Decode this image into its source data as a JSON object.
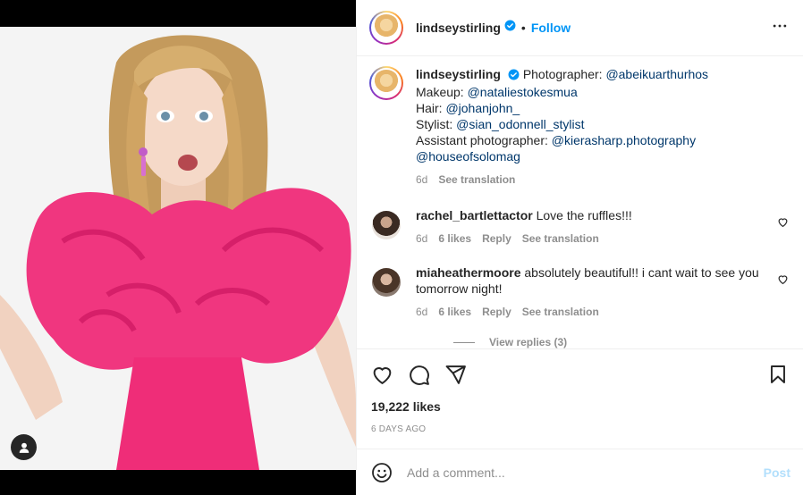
{
  "post": {
    "username": "lindseystirling",
    "follow_label": "Follow",
    "dot": "•"
  },
  "caption": {
    "username": "lindseystirling",
    "lines": [
      {
        "label": "Photographer: ",
        "handle": "@abeikuarthurhos"
      },
      {
        "label": "Makeup: ",
        "handle": "@nataliestokesmua"
      },
      {
        "label": "Hair: ",
        "handle": "@johanjohn_"
      },
      {
        "label": "Stylist: ",
        "handle": "@sian_odonnell_stylist"
      },
      {
        "label": "Assistant photographer: ",
        "handle": "@kierasharp.photography"
      },
      {
        "label": "",
        "handle": "@houseofsolomag"
      }
    ],
    "time": "6d",
    "see_translation": "See translation"
  },
  "comments": [
    {
      "username": "rachel_bartlettactor",
      "text": "Love the ruffles!!!",
      "time": "6d",
      "likes": "6 likes",
      "reply": "Reply",
      "see_translation": "See translation"
    },
    {
      "username": "miaheathermoore",
      "text": "absolutely beautiful!! i cant wait to see you tomorrow night!",
      "time": "6d",
      "likes": "6 likes",
      "reply": "Reply",
      "see_translation": "See translation"
    }
  ],
  "view_replies": "View replies (3)",
  "likes_count": "19,222 likes",
  "date": "6 DAYS AGO",
  "add_comment": {
    "placeholder": "Add a comment...",
    "post_label": "Post"
  },
  "colors": {
    "accent": "#0095f6",
    "post_disabled": "#b2dffc",
    "dress": "#f0367f"
  },
  "icons": [
    "verified-icon",
    "more-icon",
    "heart-icon",
    "comment-icon",
    "share-icon",
    "bookmark-icon",
    "emoji-icon",
    "user-tag-icon"
  ]
}
